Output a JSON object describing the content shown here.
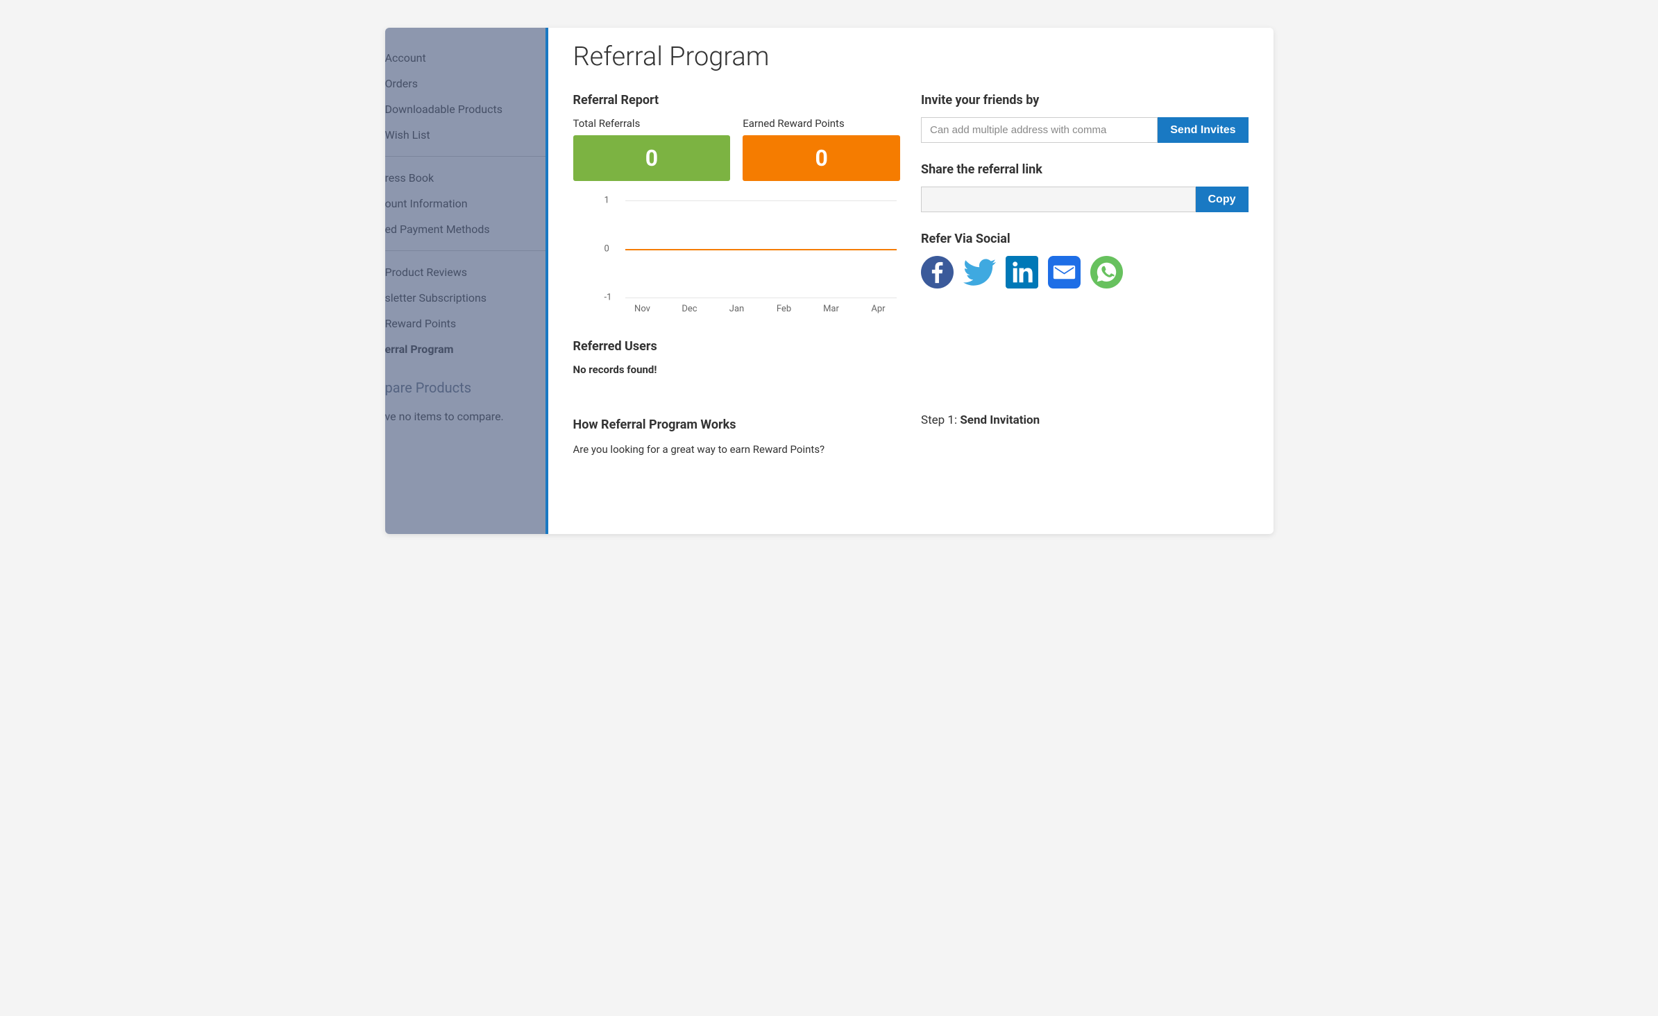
{
  "page": {
    "title": "Referral Program"
  },
  "sidebar": {
    "items": [
      {
        "label": "Account"
      },
      {
        "label": "Orders"
      },
      {
        "label": "Downloadable Products"
      },
      {
        "label": "Wish List"
      },
      {
        "label": "ress Book"
      },
      {
        "label": "ount Information"
      },
      {
        "label": "ed Payment Methods"
      },
      {
        "label": "Product Reviews"
      },
      {
        "label": "sletter Subscriptions"
      },
      {
        "label": "Reward Points"
      },
      {
        "label": "erral Program",
        "active": true
      }
    ],
    "compare_heading": "pare Products",
    "compare_note": "ve no items to compare."
  },
  "report": {
    "heading": "Referral Report",
    "total_label": "Total Referrals",
    "total_value": "0",
    "points_label": "Earned Reward Points",
    "points_value": "0"
  },
  "chart_data": {
    "type": "line",
    "categories": [
      "Nov",
      "Dec",
      "Jan",
      "Feb",
      "Mar",
      "Apr"
    ],
    "values": [
      0,
      0,
      0,
      0,
      0,
      0
    ],
    "yticks": [
      -1,
      0,
      1
    ],
    "ylim": [
      -1,
      1
    ],
    "series_color": "#f57c00"
  },
  "referred": {
    "heading": "Referred Users",
    "empty_text": "No records found!"
  },
  "how": {
    "heading": "How Referral Program Works",
    "text": "Are you looking for a great way to earn Reward Points?"
  },
  "invite": {
    "heading": "Invite your friends by",
    "placeholder": "Can add multiple address with comma",
    "button": "Send Invites"
  },
  "share": {
    "heading": "Share the referral link",
    "button": "Copy"
  },
  "social": {
    "heading": "Refer Via Social",
    "icons": {
      "facebook": "facebook-icon",
      "twitter": "twitter-icon",
      "linkedin": "linkedin-icon",
      "email": "email-icon",
      "whatsapp": "whatsapp-icon"
    }
  },
  "step": {
    "label": "Step 1: ",
    "title": "Send Invitation"
  }
}
